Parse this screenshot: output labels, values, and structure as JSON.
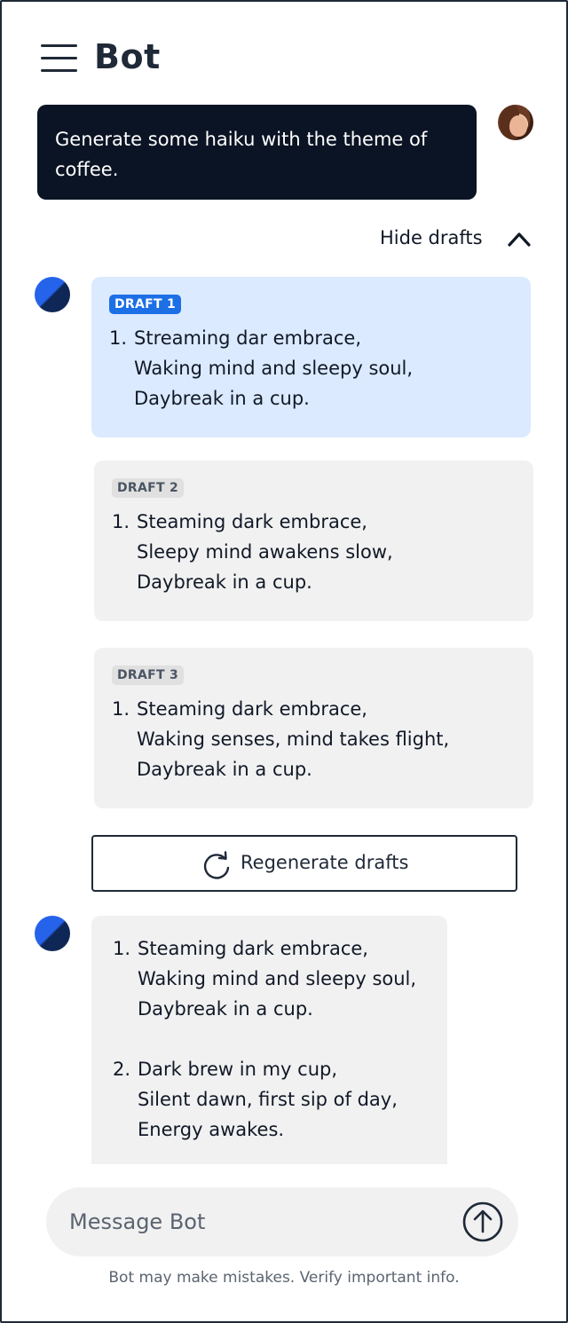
{
  "header": {
    "title": "Bot"
  },
  "user_message": {
    "text": "Generate some haiku with the theme of coffee."
  },
  "drafts_toggle": {
    "label": "Hide drafts"
  },
  "drafts": [
    {
      "badge": "DRAFT 1",
      "number": "1.",
      "lines": [
        "Streaming dar embrace,",
        "Waking mind and sleepy soul,",
        "Daybreak in a cup."
      ]
    },
    {
      "badge": "DRAFT 2",
      "number": "1.",
      "lines": [
        "Steaming dark embrace,",
        "Sleepy mind awakens slow,",
        "Daybreak in a cup."
      ]
    },
    {
      "badge": "DRAFT 3",
      "number": "1.",
      "lines": [
        "Steaming dark embrace,",
        "Waking senses, mind takes flight,",
        "Daybreak in a cup."
      ]
    }
  ],
  "regenerate": {
    "label": "Regenerate drafts"
  },
  "reply": {
    "items": [
      {
        "number": "1.",
        "lines": [
          "Steaming dark embrace,",
          "Waking mind and sleepy soul,",
          "Daybreak in a cup."
        ]
      },
      {
        "number": "2.",
        "lines": [
          "Dark brew in my cup,",
          "Silent dawn, first sip of day,",
          "Energy awakes."
        ]
      }
    ]
  },
  "composer": {
    "placeholder": "Message Bot",
    "value": ""
  },
  "disclaimer": "Bot may make mistakes. Verify important info.",
  "colors": {
    "user_bubble": "#0b1424",
    "active_draft": "#dbeafe",
    "badge_active": "#1d6fe6",
    "neutral_bubble": "#f1f1f1"
  },
  "icons": [
    "menu-icon",
    "chevron-up-icon",
    "refresh-icon",
    "send-arrow-icon"
  ]
}
